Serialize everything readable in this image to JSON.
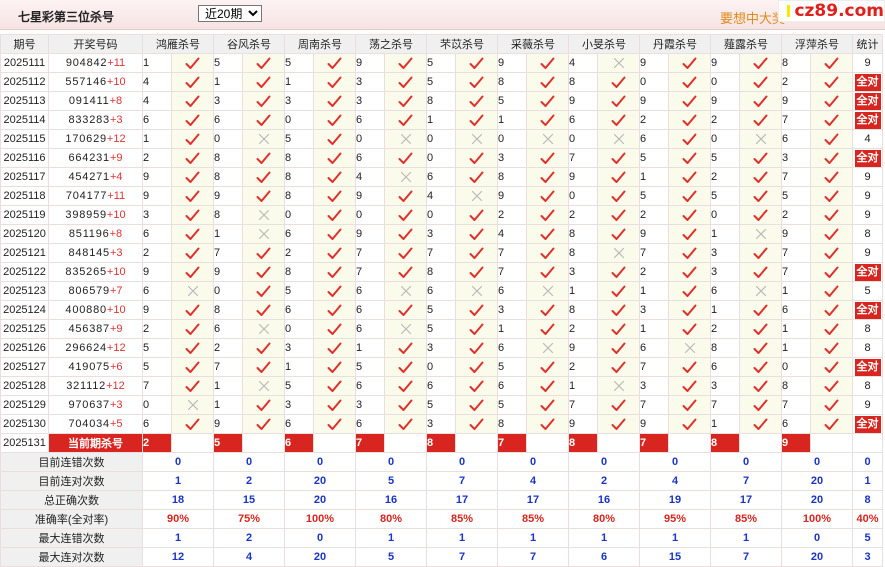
{
  "header": {
    "title": "七星彩第三位杀号",
    "period_select": "近20期",
    "promo": "要想中大奖",
    "logo": "cz89.com"
  },
  "table": {
    "headers": [
      "期号",
      "开奖号码",
      "鸿雁杀号",
      "谷风杀号",
      "周南杀号",
      "荡之杀号",
      "芣苡杀号",
      "采薇杀号",
      "小旻杀号",
      "丹霞杀号",
      "薤露杀号",
      "浮萍杀号",
      "统计"
    ],
    "quan_label": "全对",
    "rows": [
      {
        "period": "2025111",
        "main": "904842",
        "extra": "+11",
        "picks": [
          1,
          5,
          5,
          9,
          5,
          9,
          4,
          9,
          9,
          8
        ],
        "marks": [
          1,
          1,
          1,
          1,
          1,
          1,
          0,
          1,
          1,
          1
        ],
        "stat": "9"
      },
      {
        "period": "2025112",
        "main": "557146",
        "extra": "+10",
        "picks": [
          4,
          1,
          1,
          3,
          5,
          8,
          8,
          0,
          0,
          2
        ],
        "marks": [
          1,
          1,
          1,
          1,
          1,
          1,
          1,
          1,
          1,
          1
        ],
        "stat": "全对"
      },
      {
        "period": "2025113",
        "main": "091411",
        "extra": "+8",
        "picks": [
          4,
          3,
          3,
          3,
          8,
          5,
          9,
          9,
          9,
          9
        ],
        "marks": [
          1,
          1,
          1,
          1,
          1,
          1,
          1,
          1,
          1,
          1
        ],
        "stat": "全对"
      },
      {
        "period": "2025114",
        "main": "833283",
        "extra": "+3",
        "picks": [
          6,
          6,
          0,
          6,
          1,
          1,
          6,
          2,
          2,
          7
        ],
        "marks": [
          1,
          1,
          1,
          1,
          1,
          1,
          1,
          1,
          1,
          1
        ],
        "stat": "全对"
      },
      {
        "period": "2025115",
        "main": "170629",
        "extra": "+12",
        "picks": [
          1,
          0,
          5,
          0,
          0,
          0,
          0,
          6,
          0,
          6
        ],
        "marks": [
          1,
          0,
          1,
          0,
          0,
          0,
          0,
          1,
          0,
          1
        ],
        "stat": "4"
      },
      {
        "period": "2025116",
        "main": "664231",
        "extra": "+9",
        "picks": [
          2,
          8,
          8,
          6,
          0,
          3,
          7,
          5,
          5,
          3
        ],
        "marks": [
          1,
          1,
          1,
          1,
          1,
          1,
          1,
          1,
          1,
          1
        ],
        "stat": "全对"
      },
      {
        "period": "2025117",
        "main": "454271",
        "extra": "+4",
        "picks": [
          9,
          8,
          8,
          4,
          6,
          8,
          9,
          1,
          2,
          7
        ],
        "marks": [
          1,
          1,
          1,
          0,
          1,
          1,
          1,
          1,
          1,
          1
        ],
        "stat": "9"
      },
      {
        "period": "2025118",
        "main": "704177",
        "extra": "+11",
        "picks": [
          9,
          9,
          8,
          9,
          4,
          9,
          0,
          5,
          5,
          5
        ],
        "marks": [
          1,
          1,
          1,
          1,
          0,
          1,
          1,
          1,
          1,
          1
        ],
        "stat": "9"
      },
      {
        "period": "2025119",
        "main": "398959",
        "extra": "+10",
        "picks": [
          3,
          8,
          0,
          0,
          0,
          2,
          2,
          2,
          0,
          2
        ],
        "marks": [
          1,
          0,
          1,
          1,
          1,
          1,
          1,
          1,
          1,
          1
        ],
        "stat": "9"
      },
      {
        "period": "2025120",
        "main": "851196",
        "extra": "+8",
        "picks": [
          6,
          1,
          6,
          9,
          3,
          4,
          8,
          9,
          1,
          9
        ],
        "marks": [
          1,
          0,
          1,
          1,
          1,
          1,
          1,
          1,
          0,
          1
        ],
        "stat": "8"
      },
      {
        "period": "2025121",
        "main": "848145",
        "extra": "+3",
        "picks": [
          2,
          7,
          2,
          7,
          7,
          7,
          8,
          7,
          3,
          7
        ],
        "marks": [
          1,
          1,
          1,
          1,
          1,
          1,
          0,
          1,
          1,
          1
        ],
        "stat": "9"
      },
      {
        "period": "2025122",
        "main": "835265",
        "extra": "+10",
        "picks": [
          9,
          9,
          8,
          7,
          8,
          7,
          3,
          2,
          3,
          7
        ],
        "marks": [
          1,
          1,
          1,
          1,
          1,
          1,
          1,
          1,
          1,
          1
        ],
        "stat": "全对"
      },
      {
        "period": "2025123",
        "main": "806579",
        "extra": "+7",
        "picks": [
          6,
          0,
          5,
          6,
          6,
          6,
          1,
          1,
          6,
          1
        ],
        "marks": [
          0,
          1,
          1,
          0,
          0,
          0,
          1,
          1,
          0,
          1
        ],
        "stat": "5"
      },
      {
        "period": "2025124",
        "main": "400880",
        "extra": "+10",
        "picks": [
          9,
          8,
          6,
          6,
          5,
          3,
          8,
          3,
          1,
          6
        ],
        "marks": [
          1,
          1,
          1,
          1,
          1,
          1,
          1,
          1,
          1,
          1
        ],
        "stat": "全对"
      },
      {
        "period": "2025125",
        "main": "456387",
        "extra": "+9",
        "picks": [
          2,
          6,
          0,
          6,
          5,
          1,
          2,
          1,
          2,
          1
        ],
        "marks": [
          1,
          0,
          1,
          0,
          1,
          1,
          1,
          1,
          1,
          1
        ],
        "stat": "8"
      },
      {
        "period": "2025126",
        "main": "296624",
        "extra": "+12",
        "picks": [
          5,
          2,
          3,
          1,
          3,
          6,
          9,
          6,
          8,
          1
        ],
        "marks": [
          1,
          1,
          1,
          1,
          1,
          0,
          1,
          0,
          1,
          1
        ],
        "stat": "8"
      },
      {
        "period": "2025127",
        "main": "419075",
        "extra": "+6",
        "picks": [
          5,
          7,
          1,
          5,
          0,
          5,
          2,
          7,
          6,
          0
        ],
        "marks": [
          1,
          1,
          1,
          1,
          1,
          1,
          1,
          1,
          1,
          1
        ],
        "stat": "全对"
      },
      {
        "period": "2025128",
        "main": "321112",
        "extra": "+12",
        "picks": [
          7,
          1,
          5,
          6,
          6,
          6,
          1,
          3,
          3,
          8
        ],
        "marks": [
          1,
          0,
          1,
          1,
          1,
          1,
          0,
          1,
          1,
          1
        ],
        "stat": "8"
      },
      {
        "period": "2025129",
        "main": "970637",
        "extra": "+3",
        "picks": [
          0,
          1,
          3,
          3,
          5,
          5,
          7,
          7,
          7,
          7
        ],
        "marks": [
          0,
          1,
          1,
          1,
          1,
          1,
          1,
          1,
          1,
          1
        ],
        "stat": "9"
      },
      {
        "period": "2025130",
        "main": "704034",
        "extra": "+5",
        "picks": [
          6,
          9,
          6,
          6,
          3,
          8,
          9,
          9,
          1,
          6
        ],
        "marks": [
          1,
          1,
          1,
          1,
          1,
          1,
          1,
          1,
          1,
          1
        ],
        "stat": "全对"
      }
    ],
    "current": {
      "period": "2025131",
      "label": "当前期杀号",
      "picks": [
        "2",
        "5",
        "6",
        "7",
        "8",
        "7",
        "8",
        "7",
        "8",
        "9"
      ]
    },
    "summary": [
      {
        "label": "目前连错次数",
        "color": "blue",
        "values": [
          "0",
          "0",
          "0",
          "0",
          "0",
          "0",
          "0",
          "0",
          "0",
          "0",
          "0"
        ]
      },
      {
        "label": "目前连对次数",
        "color": "blue",
        "values": [
          "1",
          "2",
          "20",
          "5",
          "7",
          "4",
          "2",
          "4",
          "7",
          "20",
          "1"
        ]
      },
      {
        "label": "总正确次数",
        "color": "blue",
        "values": [
          "18",
          "15",
          "20",
          "16",
          "17",
          "17",
          "16",
          "19",
          "17",
          "20",
          "8"
        ]
      },
      {
        "label": "准确率(全对率)",
        "color": "red",
        "values": [
          "90%",
          "75%",
          "100%",
          "80%",
          "85%",
          "85%",
          "80%",
          "95%",
          "85%",
          "100%",
          "40%"
        ]
      },
      {
        "label": "最大连错次数",
        "color": "blue",
        "values": [
          "1",
          "2",
          "0",
          "1",
          "1",
          "1",
          "1",
          "1",
          "1",
          "0",
          "5"
        ]
      },
      {
        "label": "最大连对次数",
        "color": "blue",
        "values": [
          "12",
          "4",
          "20",
          "5",
          "7",
          "7",
          "6",
          "15",
          "7",
          "20",
          "3"
        ]
      }
    ]
  },
  "colors": {
    "check": "#e0302b",
    "cross": "#b9b9b9",
    "accent": "#d8251f",
    "summary_blue": "#1a34c7"
  }
}
